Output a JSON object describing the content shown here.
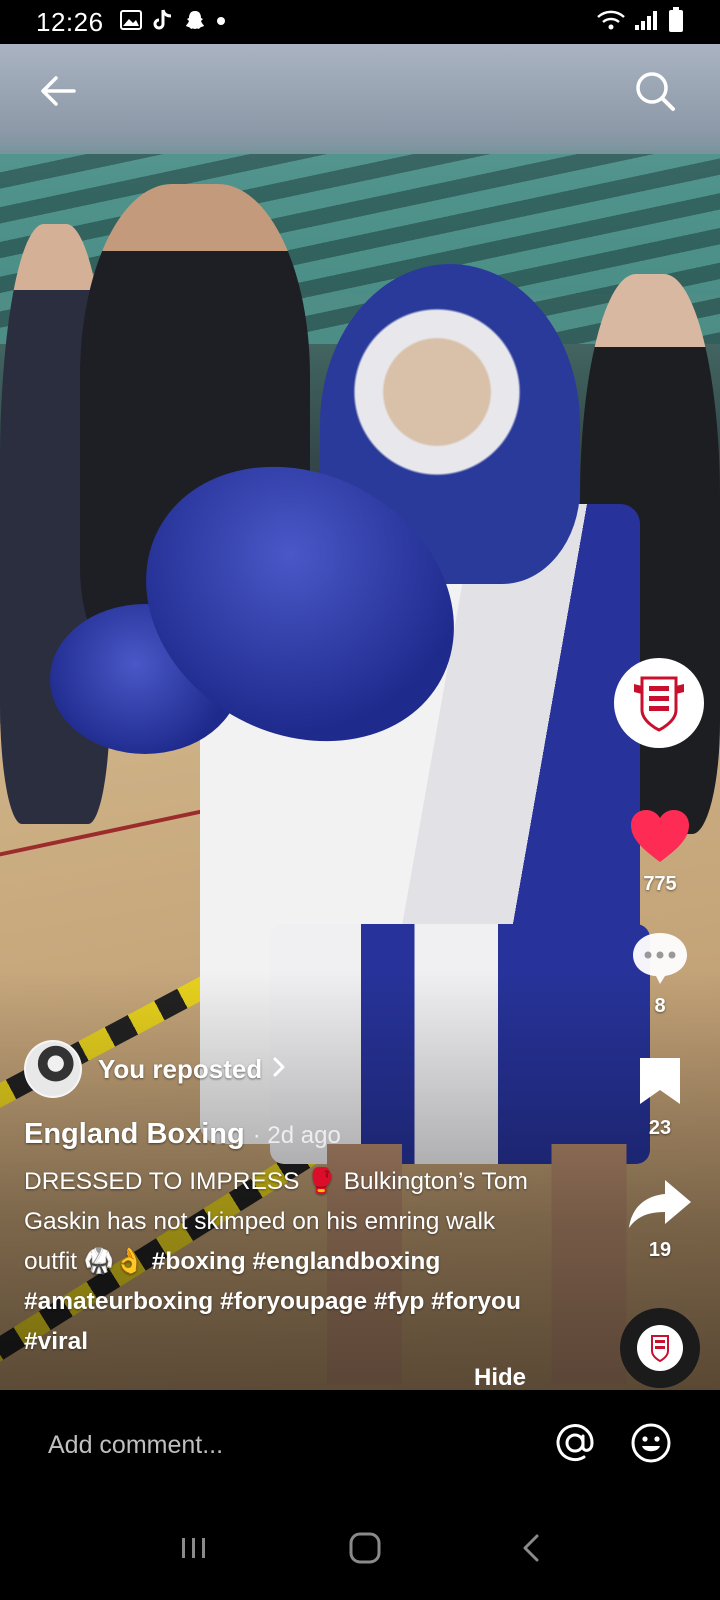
{
  "status_bar": {
    "time": "12:26",
    "notification_icons": [
      "gallery-icon",
      "tiktok-icon",
      "snapchat-icon",
      "dot-icon"
    ],
    "system_icons": [
      "wifi-icon",
      "signal-icon",
      "battery-icon"
    ]
  },
  "video": {
    "top_controls": {
      "back": "back-arrow-icon",
      "search": "search-icon"
    }
  },
  "right_rail": {
    "profile_logo_text": "ENGLAND BOXING",
    "likes": "775",
    "comments": "8",
    "saves": "23",
    "shares": "19"
  },
  "repost": {
    "label": "You reposted"
  },
  "post": {
    "author": "England Boxing",
    "age": "· 2d ago",
    "caption_text": "DRESSED TO IMPRESS 🥊 Bulkington’s Tom Gaskin has not skimped on his emring walk outfit 🥋👌",
    "hashtags": [
      "#boxing",
      "#englandboxing",
      "#amateurboxing",
      "#foryoupage",
      "#fyp",
      "#foryou",
      "#viral"
    ],
    "hide_label": "Hide"
  },
  "comment_bar": {
    "placeholder": "Add comment..."
  },
  "colors": {
    "like_red": "#fe2c55",
    "background": "#000000",
    "boxer_blue": "#27339a"
  }
}
